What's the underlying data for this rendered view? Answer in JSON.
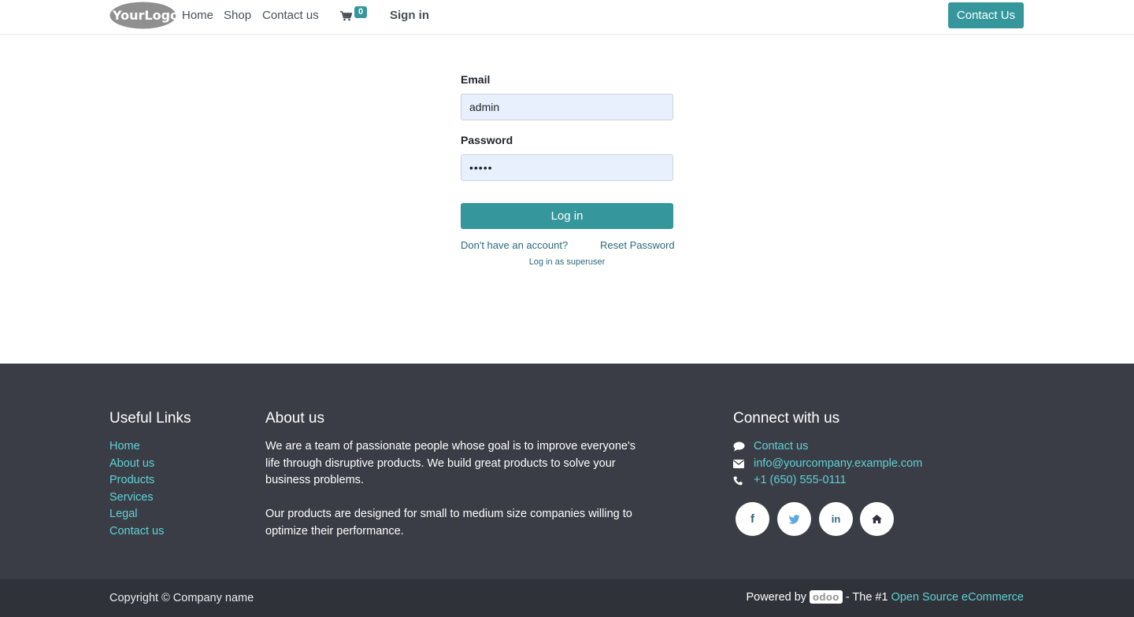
{
  "header": {
    "logo_text": "YourLogo",
    "nav": [
      "Home",
      "Shop",
      "Contact us"
    ],
    "cart_count": "0",
    "signin_label": "Sign in",
    "cta_label": "Contact Us"
  },
  "login": {
    "email_label": "Email",
    "email_value": "admin",
    "password_label": "Password",
    "password_value": "•••••",
    "submit_label": "Log in",
    "signup_link": "Don't have an account?",
    "reset_link": "Reset Password",
    "superuser_link": "Log in as superuser"
  },
  "footer": {
    "useful_links_heading": "Useful Links",
    "useful_links": [
      "Home",
      "About us",
      "Products",
      "Services",
      "Legal",
      "Contact us"
    ],
    "about_heading": "About us",
    "about_paragraphs": [
      "We are a team of passionate people whose goal is to improve everyone's life through disruptive products. We build great products to solve your business problems.",
      "Our products are designed for small to medium size companies willing to optimize their performance."
    ],
    "connect_heading": "Connect with us",
    "connect_items": [
      {
        "icon": "comment-icon",
        "text": "Contact us"
      },
      {
        "icon": "envelope-icon",
        "text": "info@yourcompany.example.com"
      },
      {
        "icon": "phone-icon",
        "text": "+1 (650) 555-0111"
      }
    ],
    "social_icons": [
      "facebook-icon",
      "twitter-icon",
      "linkedin-icon",
      "home-icon"
    ]
  },
  "bottom_bar": {
    "copyright": "Copyright © Company name",
    "powered_by": "Powered by",
    "powered_brand": "odoo",
    "powered_mid": "- The #1",
    "powered_link": "Open Source eCommerce"
  },
  "colors": {
    "accent": "#35979c",
    "footer_bg": "#3a3d45",
    "bottom_bg": "#2f3238",
    "footer_link": "#5ed3d8",
    "input_bg": "#e8f0fe"
  }
}
